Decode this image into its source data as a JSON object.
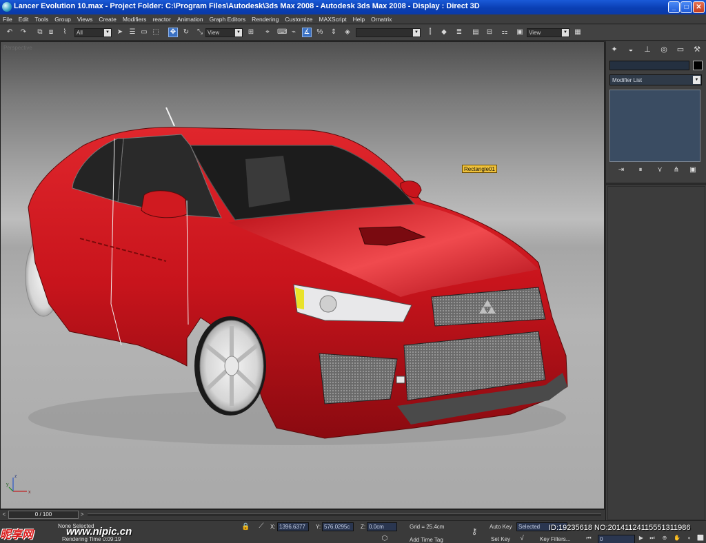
{
  "titlebar": {
    "title": "Lancer Evolution 10.max     - Project Folder: C:\\Program Files\\Autodesk\\3ds Max 2008     - Autodesk 3ds Max 2008     - Display : Direct 3D",
    "minimize": "_",
    "maximize": "□",
    "close": "✕"
  },
  "menu": [
    "File",
    "Edit",
    "Tools",
    "Group",
    "Views",
    "Create",
    "Modifiers",
    "reactor",
    "Animation",
    "Graph Editors",
    "Rendering",
    "Customize",
    "MAXScript",
    "Help",
    "Ornatrix"
  ],
  "toolbar": {
    "selection_filter": "All",
    "ref_coord_1": "View",
    "named_selection": "",
    "ref_coord_2": "View",
    "dropdown_arrow": "▼"
  },
  "viewport": {
    "label": "Perspective",
    "object_label": "Rectangle01",
    "axis": {
      "x": "x",
      "y": "y",
      "z": "z"
    }
  },
  "command_panel": {
    "modifier_list": "Modifier List",
    "object_name": "",
    "object_color": "#000000"
  },
  "timeline": {
    "frame_display": "0 / 100",
    "prev": "<",
    "next": ">"
  },
  "status": {
    "selection": "None Selected",
    "rendering_time": "Rendering Time  0:09:19",
    "x_label": "X:",
    "x_value": "1396.6377",
    "y_label": "Y:",
    "y_value": "576.0295c",
    "z_label": "Z:",
    "z_value": "0.0cm",
    "grid": "Grid = 25.4cm",
    "add_time_tag": "Add Time Tag",
    "auto_key": "Auto Key",
    "auto_key_mode": "Selected",
    "set_key": "Set Key",
    "key_filters": "Key Filters...",
    "frame": "0"
  },
  "watermark": {
    "logo": "昵享网",
    "url": "www.nipic.cn",
    "id": "ID:19235618 NO:20141124115551311986"
  },
  "colors": {
    "car_body": "#c8141c",
    "viewport_bg": "#b0b0b0",
    "selection_label_bg": "#f0c23a",
    "titlebar": "#0a3fb4"
  }
}
